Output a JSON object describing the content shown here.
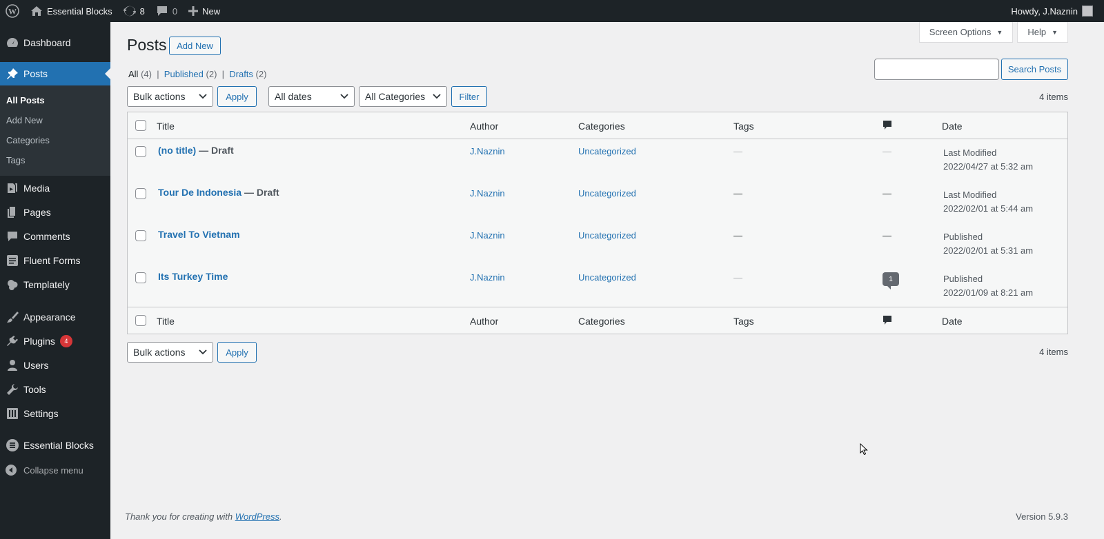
{
  "adminbar": {
    "site_name": "Essential Blocks",
    "updates_count": "8",
    "comments_count": "0",
    "new_label": "New",
    "howdy": "Howdy, J.Naznin"
  },
  "sidebar": {
    "dashboard": "Dashboard",
    "posts": "Posts",
    "posts_sub": [
      "All Posts",
      "Add New",
      "Categories",
      "Tags"
    ],
    "media": "Media",
    "pages": "Pages",
    "comments": "Comments",
    "fluent_forms": "Fluent Forms",
    "templately": "Templately",
    "appearance": "Appearance",
    "plugins": "Plugins",
    "plugins_badge": "4",
    "users": "Users",
    "tools": "Tools",
    "settings": "Settings",
    "essential_blocks": "Essential Blocks",
    "collapse": "Collapse menu"
  },
  "screen_meta": {
    "screen_options": "Screen Options",
    "help": "Help"
  },
  "main": {
    "title": "Posts",
    "add_new": "Add New",
    "filters": {
      "all": "All",
      "all_count": "(4)",
      "published": "Published",
      "published_count": "(2)",
      "drafts": "Drafts",
      "drafts_count": "(2)"
    },
    "search_button": "Search Posts",
    "bulk_actions": "Bulk actions",
    "apply": "Apply",
    "all_dates": "All dates",
    "all_categories": "All Categories",
    "filter": "Filter",
    "items_count": "4 items",
    "columns": {
      "title": "Title",
      "author": "Author",
      "categories": "Categories",
      "tags": "Tags",
      "date": "Date"
    },
    "rows": [
      {
        "title": "(no title)",
        "state": "— Draft",
        "author": "J.Naznin",
        "category": "Uncategorized",
        "tags": "—",
        "comments": "—",
        "date_status": "Last Modified",
        "date": "2022/04/27 at 5:32 am"
      },
      {
        "title": "Tour De Indonesia",
        "state": "— Draft",
        "author": "J.Naznin",
        "category": "Uncategorized",
        "tags": "—",
        "comments": "—",
        "date_status": "Last Modified",
        "date": "2022/02/01 at 5:44 am"
      },
      {
        "title": "Travel To Vietnam",
        "state": "",
        "author": "J.Naznin",
        "category": "Uncategorized",
        "tags": "—",
        "comments": "—",
        "date_status": "Published",
        "date": "2022/02/01 at 5:31 am"
      },
      {
        "title": "Its Turkey Time",
        "state": "",
        "author": "J.Naznin",
        "category": "Uncategorized",
        "tags": "—",
        "comments": "1",
        "date_status": "Published",
        "date": "2022/01/09 at 8:21 am"
      }
    ]
  },
  "footer": {
    "thanks_prefix": "Thank you for creating with ",
    "thanks_link": "WordPress",
    "thanks_suffix": ".",
    "version": "Version 5.9.3"
  }
}
